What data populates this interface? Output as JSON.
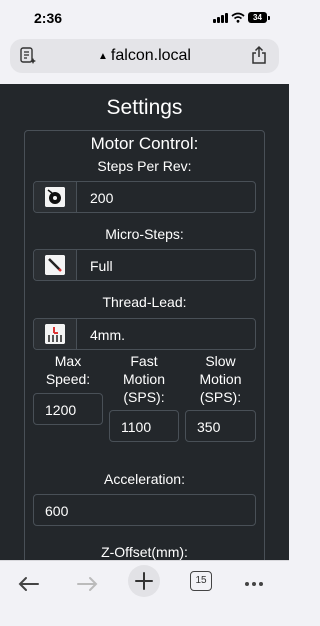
{
  "status_bar": {
    "time": "2:36",
    "battery": "34"
  },
  "browser": {
    "url": "falcon.local",
    "tabs_count": "15"
  },
  "page": {
    "title": "Settings",
    "section": "Motor Control:",
    "steps_per_rev": {
      "label": "Steps Per Rev:",
      "value": "200"
    },
    "micro_steps": {
      "label": "Micro-Steps:",
      "value": "Full"
    },
    "thread_lead": {
      "label": "Thread-Lead:",
      "value": "4mm."
    },
    "max_speed": {
      "label": "Max Speed:",
      "value": "1200"
    },
    "fast_motion": {
      "label": "Fast Motion (SPS):",
      "value": "1100"
    },
    "slow_motion": {
      "label": "Slow Motion (SPS):",
      "value": "350"
    },
    "acceleration": {
      "label": "Acceleration:",
      "value": "600"
    },
    "z_offset": {
      "label": "Z-Offset(mm):"
    }
  },
  "icons": {
    "steps_per_rev": "motor-disc-icon",
    "micro_steps": "pencil-icon",
    "thread_lead": "thread-lead-icon"
  }
}
